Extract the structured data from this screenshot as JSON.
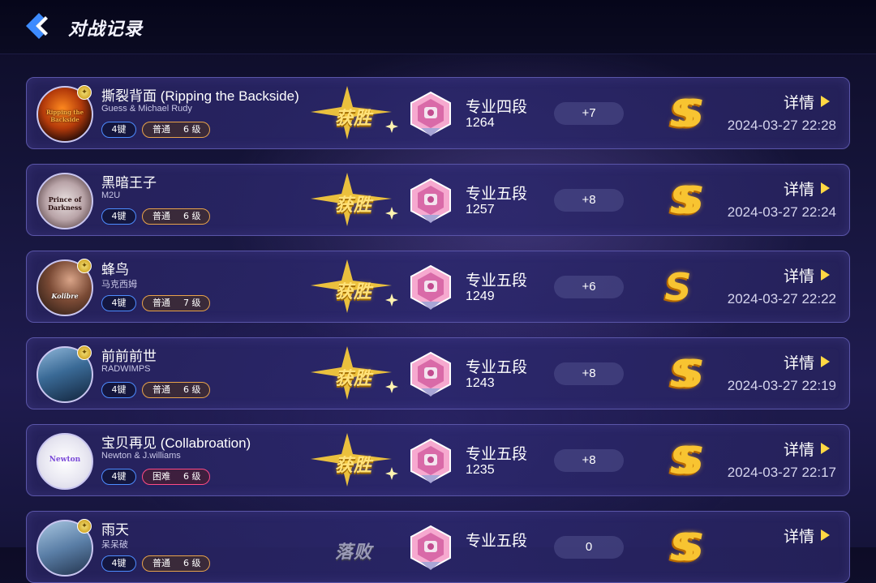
{
  "header": {
    "title": "对战记录"
  },
  "colors": {
    "win": "#ffe27a",
    "accent": "#ffd843",
    "key_tag": "#4d8cff",
    "normal_tag": "#e8a34b",
    "hard_tag": "#ff4b86"
  },
  "records": [
    {
      "title": "撕裂背面 (Ripping the Backside)",
      "artist": "Guess & Michael Rudy",
      "cover_text": "Ripping the Backside",
      "keys": "4键",
      "difficulty": "普通",
      "level": "6 级",
      "difficulty_type": "normal",
      "result": "获胜",
      "rank": "专业四段",
      "score": "1264",
      "delta": "+7",
      "grade": "SS",
      "detail": "详情",
      "datetime": "2024-03-27 22:28"
    },
    {
      "title": "黑暗王子",
      "artist": "M2U",
      "cover_text": "Prince of Darkness",
      "keys": "4键",
      "difficulty": "普通",
      "level": "6 级",
      "difficulty_type": "normal",
      "result": "获胜",
      "rank": "专业五段",
      "score": "1257",
      "delta": "+8",
      "grade": "SS",
      "detail": "详情",
      "datetime": "2024-03-27 22:24"
    },
    {
      "title": "蜂鸟",
      "artist": "马克西姆",
      "cover_text": "Kolibre",
      "keys": "4键",
      "difficulty": "普通",
      "level": "7 级",
      "difficulty_type": "normal",
      "result": "获胜",
      "rank": "专业五段",
      "score": "1249",
      "delta": "+6",
      "grade": "S",
      "detail": "详情",
      "datetime": "2024-03-27 22:22"
    },
    {
      "title": "前前前世",
      "artist": "RADWIMPS",
      "cover_text": "",
      "keys": "4键",
      "difficulty": "普通",
      "level": "6 级",
      "difficulty_type": "normal",
      "result": "获胜",
      "rank": "专业五段",
      "score": "1243",
      "delta": "+8",
      "grade": "SS",
      "detail": "详情",
      "datetime": "2024-03-27 22:19"
    },
    {
      "title": "宝贝再见 (Collabroation)",
      "artist": "Newton & J.williams",
      "cover_text": "Newton",
      "keys": "4键",
      "difficulty": "困难",
      "level": "6 级",
      "difficulty_type": "hard",
      "result": "获胜",
      "rank": "专业五段",
      "score": "1235",
      "delta": "+8",
      "grade": "SS",
      "detail": "详情",
      "datetime": "2024-03-27 22:17"
    },
    {
      "title": "雨天",
      "artist": "呆呆破",
      "cover_text": "",
      "keys": "4键",
      "difficulty": "普通",
      "level": "6 级",
      "difficulty_type": "normal",
      "result": "落败",
      "rank": "专业五段",
      "score": "",
      "delta": "0",
      "grade": "SS",
      "detail": "详情",
      "datetime": ""
    }
  ]
}
